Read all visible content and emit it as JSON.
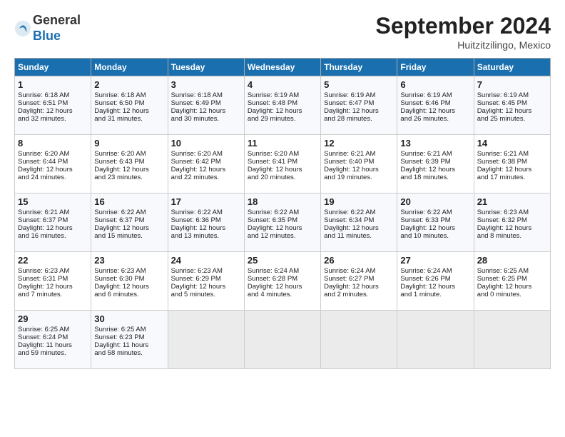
{
  "header": {
    "logo_general": "General",
    "logo_blue": "Blue",
    "month_title": "September 2024",
    "location": "Huitzitzilingo, Mexico"
  },
  "days_of_week": [
    "Sunday",
    "Monday",
    "Tuesday",
    "Wednesday",
    "Thursday",
    "Friday",
    "Saturday"
  ],
  "weeks": [
    [
      {
        "day": "1",
        "line1": "Sunrise: 6:18 AM",
        "line2": "Sunset: 6:51 PM",
        "line3": "Daylight: 12 hours",
        "line4": "and 32 minutes."
      },
      {
        "day": "2",
        "line1": "Sunrise: 6:18 AM",
        "line2": "Sunset: 6:50 PM",
        "line3": "Daylight: 12 hours",
        "line4": "and 31 minutes."
      },
      {
        "day": "3",
        "line1": "Sunrise: 6:18 AM",
        "line2": "Sunset: 6:49 PM",
        "line3": "Daylight: 12 hours",
        "line4": "and 30 minutes."
      },
      {
        "day": "4",
        "line1": "Sunrise: 6:19 AM",
        "line2": "Sunset: 6:48 PM",
        "line3": "Daylight: 12 hours",
        "line4": "and 29 minutes."
      },
      {
        "day": "5",
        "line1": "Sunrise: 6:19 AM",
        "line2": "Sunset: 6:47 PM",
        "line3": "Daylight: 12 hours",
        "line4": "and 28 minutes."
      },
      {
        "day": "6",
        "line1": "Sunrise: 6:19 AM",
        "line2": "Sunset: 6:46 PM",
        "line3": "Daylight: 12 hours",
        "line4": "and 26 minutes."
      },
      {
        "day": "7",
        "line1": "Sunrise: 6:19 AM",
        "line2": "Sunset: 6:45 PM",
        "line3": "Daylight: 12 hours",
        "line4": "and 25 minutes."
      }
    ],
    [
      {
        "day": "8",
        "line1": "Sunrise: 6:20 AM",
        "line2": "Sunset: 6:44 PM",
        "line3": "Daylight: 12 hours",
        "line4": "and 24 minutes."
      },
      {
        "day": "9",
        "line1": "Sunrise: 6:20 AM",
        "line2": "Sunset: 6:43 PM",
        "line3": "Daylight: 12 hours",
        "line4": "and 23 minutes."
      },
      {
        "day": "10",
        "line1": "Sunrise: 6:20 AM",
        "line2": "Sunset: 6:42 PM",
        "line3": "Daylight: 12 hours",
        "line4": "and 22 minutes."
      },
      {
        "day": "11",
        "line1": "Sunrise: 6:20 AM",
        "line2": "Sunset: 6:41 PM",
        "line3": "Daylight: 12 hours",
        "line4": "and 20 minutes."
      },
      {
        "day": "12",
        "line1": "Sunrise: 6:21 AM",
        "line2": "Sunset: 6:40 PM",
        "line3": "Daylight: 12 hours",
        "line4": "and 19 minutes."
      },
      {
        "day": "13",
        "line1": "Sunrise: 6:21 AM",
        "line2": "Sunset: 6:39 PM",
        "line3": "Daylight: 12 hours",
        "line4": "and 18 minutes."
      },
      {
        "day": "14",
        "line1": "Sunrise: 6:21 AM",
        "line2": "Sunset: 6:38 PM",
        "line3": "Daylight: 12 hours",
        "line4": "and 17 minutes."
      }
    ],
    [
      {
        "day": "15",
        "line1": "Sunrise: 6:21 AM",
        "line2": "Sunset: 6:37 PM",
        "line3": "Daylight: 12 hours",
        "line4": "and 16 minutes."
      },
      {
        "day": "16",
        "line1": "Sunrise: 6:22 AM",
        "line2": "Sunset: 6:37 PM",
        "line3": "Daylight: 12 hours",
        "line4": "and 15 minutes."
      },
      {
        "day": "17",
        "line1": "Sunrise: 6:22 AM",
        "line2": "Sunset: 6:36 PM",
        "line3": "Daylight: 12 hours",
        "line4": "and 13 minutes."
      },
      {
        "day": "18",
        "line1": "Sunrise: 6:22 AM",
        "line2": "Sunset: 6:35 PM",
        "line3": "Daylight: 12 hours",
        "line4": "and 12 minutes."
      },
      {
        "day": "19",
        "line1": "Sunrise: 6:22 AM",
        "line2": "Sunset: 6:34 PM",
        "line3": "Daylight: 12 hours",
        "line4": "and 11 minutes."
      },
      {
        "day": "20",
        "line1": "Sunrise: 6:22 AM",
        "line2": "Sunset: 6:33 PM",
        "line3": "Daylight: 12 hours",
        "line4": "and 10 minutes."
      },
      {
        "day": "21",
        "line1": "Sunrise: 6:23 AM",
        "line2": "Sunset: 6:32 PM",
        "line3": "Daylight: 12 hours",
        "line4": "and 8 minutes."
      }
    ],
    [
      {
        "day": "22",
        "line1": "Sunrise: 6:23 AM",
        "line2": "Sunset: 6:31 PM",
        "line3": "Daylight: 12 hours",
        "line4": "and 7 minutes."
      },
      {
        "day": "23",
        "line1": "Sunrise: 6:23 AM",
        "line2": "Sunset: 6:30 PM",
        "line3": "Daylight: 12 hours",
        "line4": "and 6 minutes."
      },
      {
        "day": "24",
        "line1": "Sunrise: 6:23 AM",
        "line2": "Sunset: 6:29 PM",
        "line3": "Daylight: 12 hours",
        "line4": "and 5 minutes."
      },
      {
        "day": "25",
        "line1": "Sunrise: 6:24 AM",
        "line2": "Sunset: 6:28 PM",
        "line3": "Daylight: 12 hours",
        "line4": "and 4 minutes."
      },
      {
        "day": "26",
        "line1": "Sunrise: 6:24 AM",
        "line2": "Sunset: 6:27 PM",
        "line3": "Daylight: 12 hours",
        "line4": "and 2 minutes."
      },
      {
        "day": "27",
        "line1": "Sunrise: 6:24 AM",
        "line2": "Sunset: 6:26 PM",
        "line3": "Daylight: 12 hours",
        "line4": "and 1 minute."
      },
      {
        "day": "28",
        "line1": "Sunrise: 6:25 AM",
        "line2": "Sunset: 6:25 PM",
        "line3": "Daylight: 12 hours",
        "line4": "and 0 minutes."
      }
    ],
    [
      {
        "day": "29",
        "line1": "Sunrise: 6:25 AM",
        "line2": "Sunset: 6:24 PM",
        "line3": "Daylight: 11 hours",
        "line4": "and 59 minutes."
      },
      {
        "day": "30",
        "line1": "Sunrise: 6:25 AM",
        "line2": "Sunset: 6:23 PM",
        "line3": "Daylight: 11 hours",
        "line4": "and 58 minutes."
      },
      {
        "day": "",
        "line1": "",
        "line2": "",
        "line3": "",
        "line4": ""
      },
      {
        "day": "",
        "line1": "",
        "line2": "",
        "line3": "",
        "line4": ""
      },
      {
        "day": "",
        "line1": "",
        "line2": "",
        "line3": "",
        "line4": ""
      },
      {
        "day": "",
        "line1": "",
        "line2": "",
        "line3": "",
        "line4": ""
      },
      {
        "day": "",
        "line1": "",
        "line2": "",
        "line3": "",
        "line4": ""
      }
    ]
  ]
}
